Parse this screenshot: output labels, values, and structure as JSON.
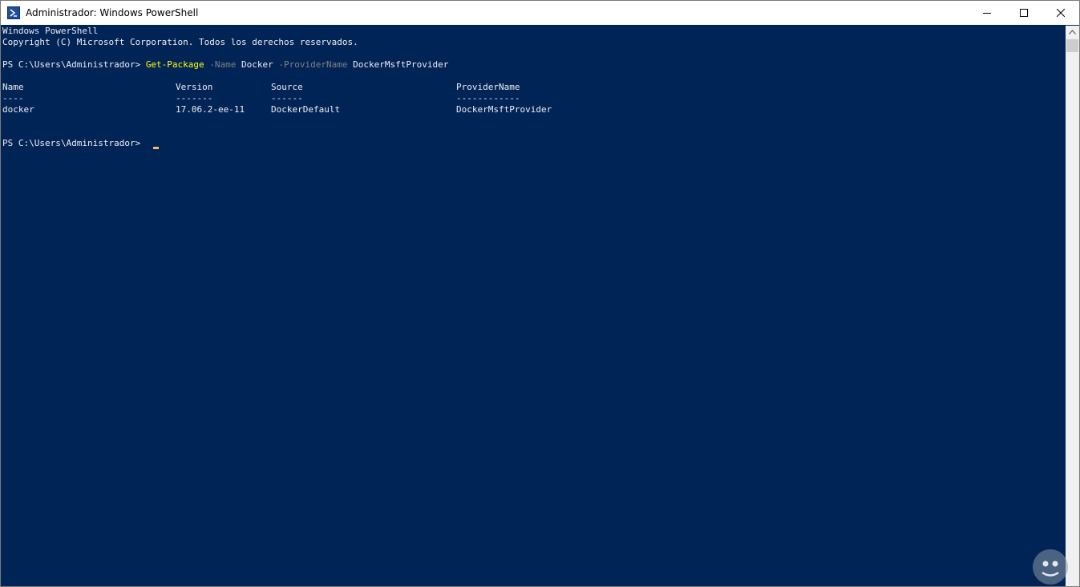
{
  "window": {
    "title": "Administrador: Windows PowerShell",
    "icon": "powershell-icon",
    "controls": [
      "minimize-icon",
      "maximize-icon",
      "close-icon"
    ]
  },
  "console": {
    "header": [
      "Windows PowerShell",
      "Copyright (C) Microsoft Corporation. Todos los derechos reservados."
    ],
    "command": {
      "prompt": "PS C:\\Users\\Administrador>",
      "cmdlet": "Get-Package",
      "param1": "-Name",
      "value1": "Docker",
      "param2": "-ProviderName",
      "value2": "DockerMsftProvider"
    },
    "table": {
      "headers": [
        "Name",
        "Version",
        "Source",
        "ProviderName"
      ],
      "separators": [
        "----",
        "-------",
        "------",
        "------------"
      ],
      "rows": [
        [
          "docker",
          "17.06.2-ee-11",
          "DockerDefault",
          "DockerMsftProvider"
        ]
      ]
    },
    "final_prompt": "PS C:\\Users\\Administrador>"
  },
  "colors": {
    "background": "#012456",
    "text": "#eeedf0",
    "cmdlet": "#ffff00",
    "parameter": "#808080",
    "cursor": "#f5b971"
  }
}
